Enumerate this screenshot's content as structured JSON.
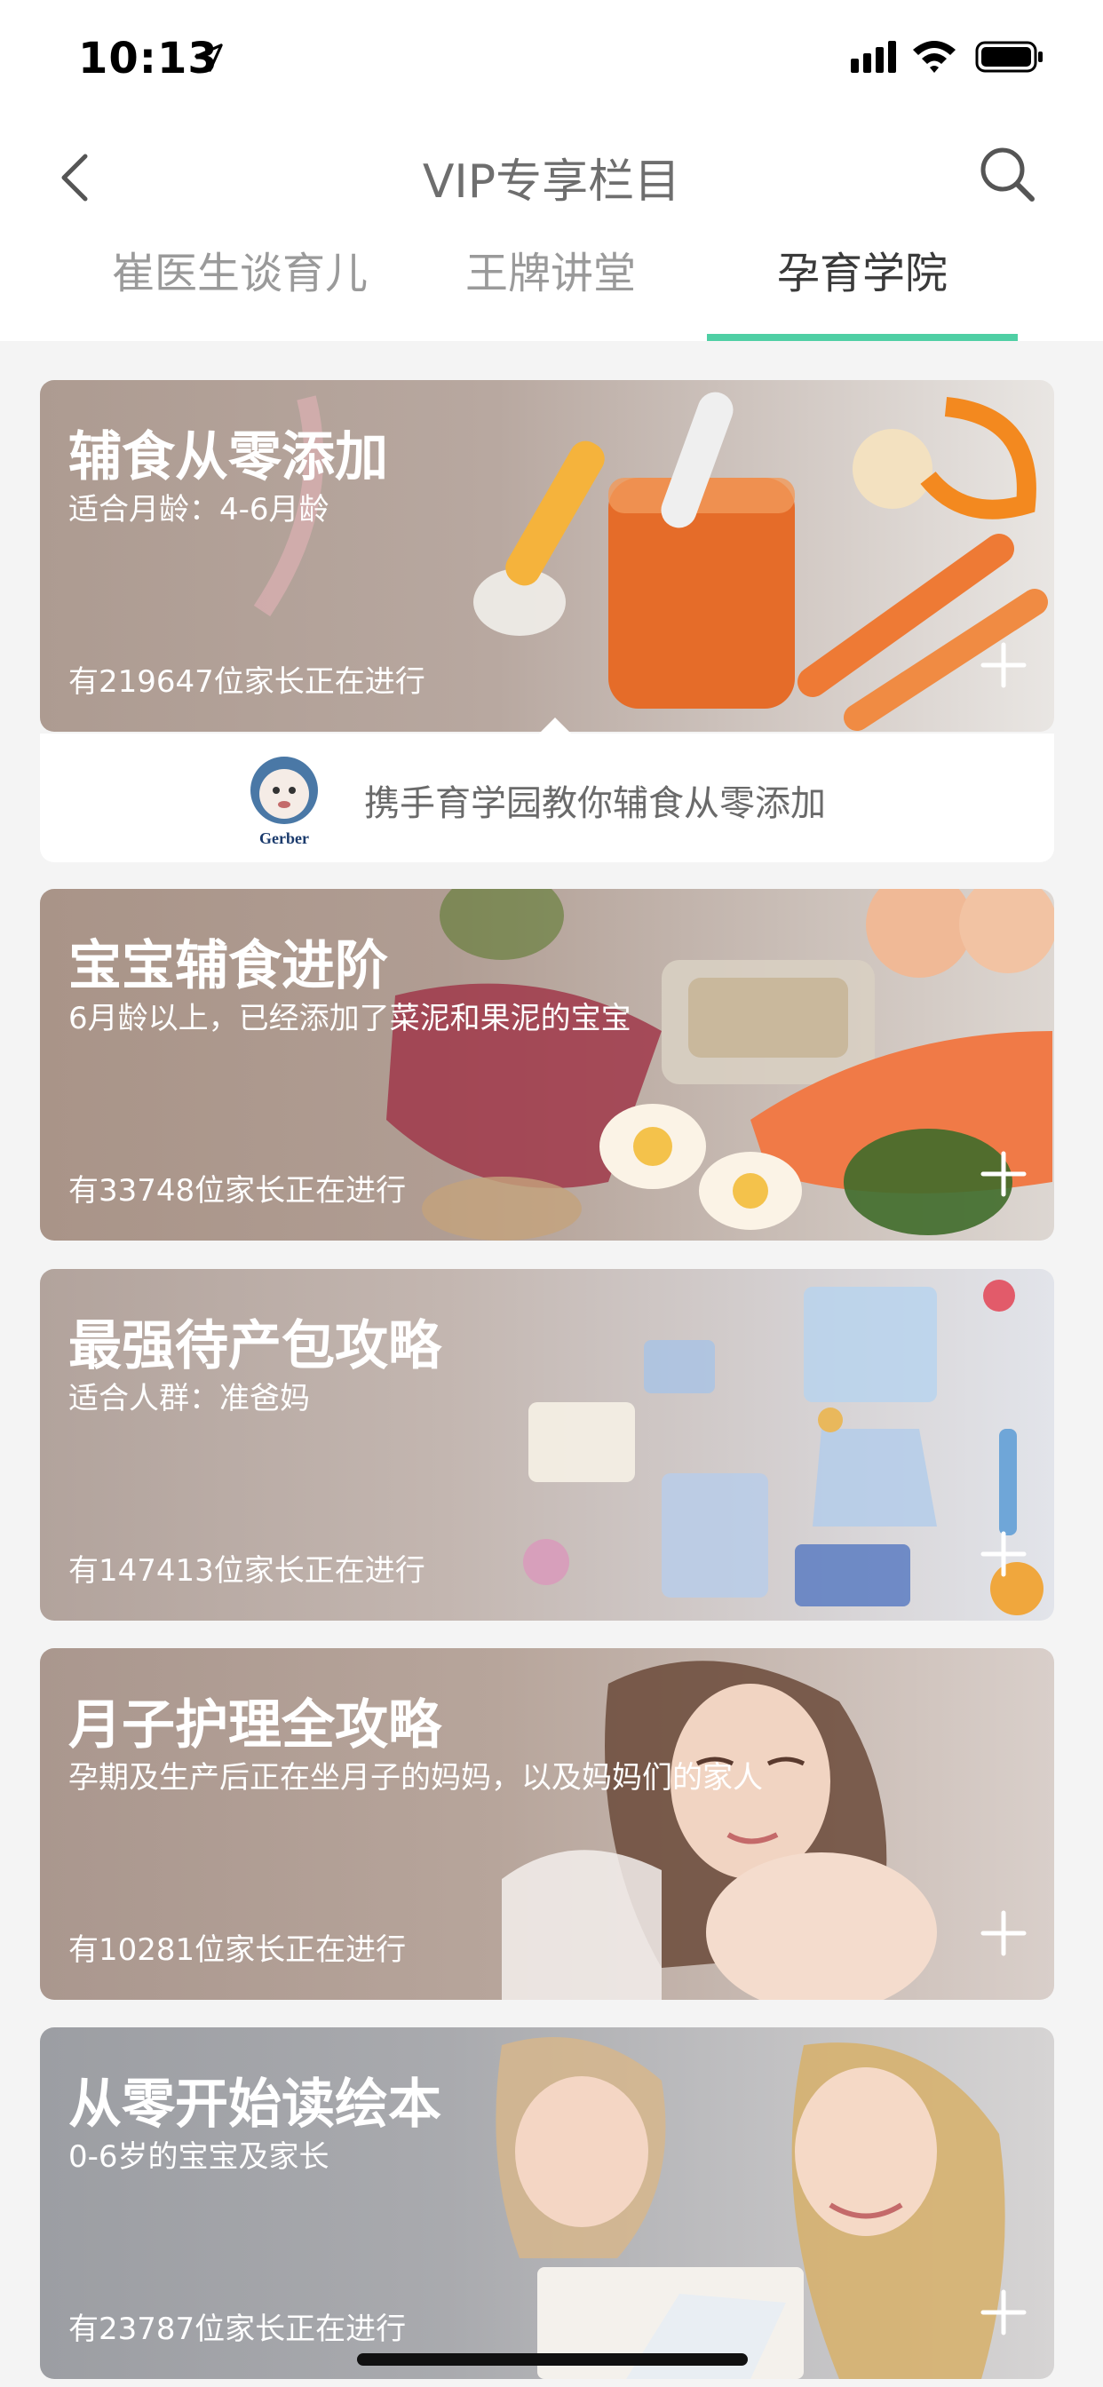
{
  "status_bar": {
    "time": "10:13"
  },
  "header": {
    "title": "VIP专享栏目",
    "tabs": [
      {
        "label": "崔医生谈育儿",
        "active": false
      },
      {
        "label": "王牌讲堂",
        "active": false
      },
      {
        "label": "孕育学院",
        "active": true
      }
    ]
  },
  "cards": [
    {
      "title": "辅食从零添加",
      "subtitle": "适合月龄：4-6月龄",
      "count": "有219647位家长正在进行"
    },
    {
      "title": "宝宝辅食进阶",
      "subtitle": "6月龄以上，已经添加了菜泥和果泥的宝宝",
      "count": "有33748位家长正在进行"
    },
    {
      "title": "最强待产包攻略",
      "subtitle": "适合人群：准爸妈",
      "count": "有147413位家长正在进行"
    },
    {
      "title": "月子护理全攻略",
      "subtitle": "孕期及生产后正在坐月子的妈妈，以及妈妈们的家人",
      "count": "有10281位家长正在进行"
    },
    {
      "title": "从零开始读绘本",
      "subtitle": "0-6岁的宝宝及家长",
      "count": "有23787位家长正在进行"
    }
  ],
  "sponsor": {
    "text": "携手育学园教你辅食从零添加",
    "logo_text": "Gerber"
  },
  "colors": {
    "accent": "#4fcfa4",
    "card_overlay": "#a99890"
  }
}
